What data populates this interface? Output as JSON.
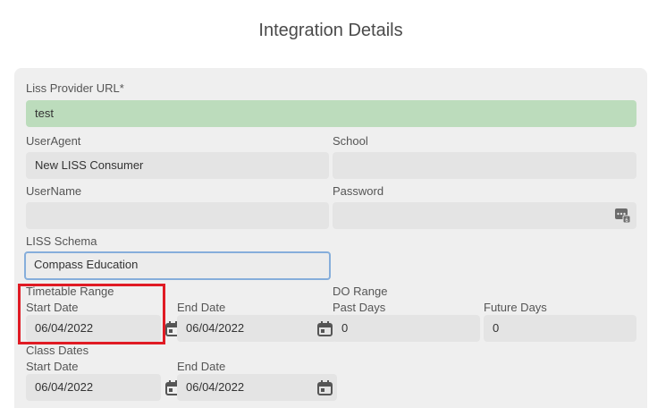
{
  "page": {
    "title": "Integration Details"
  },
  "form": {
    "liss_provider_url": {
      "label": "Liss Provider URL*",
      "value": "test"
    },
    "user_agent": {
      "label": "UserAgent",
      "value": "New LISS Consumer"
    },
    "school": {
      "label": "School",
      "value": ""
    },
    "username": {
      "label": "UserName",
      "value": ""
    },
    "password": {
      "label": "Password",
      "value": "",
      "icon": "password-manager-icon"
    },
    "liss_schema": {
      "label": "LISS Schema",
      "value": "Compass Education"
    },
    "timetable_range": {
      "label": "Timetable Range",
      "start_date": {
        "label": "Start Date",
        "value": "06/04/2022"
      },
      "end_date": {
        "label": "End Date",
        "value": "06/04/2022"
      }
    },
    "do_range": {
      "label": "DO Range",
      "past_days": {
        "label": "Past Days",
        "value": "0"
      },
      "future_days": {
        "label": "Future Days",
        "value": "0"
      }
    },
    "class_dates": {
      "label": "Class Dates",
      "start_date": {
        "label": "Start Date",
        "value": "06/04/2022"
      },
      "end_date": {
        "label": "End Date",
        "value": "06/04/2022"
      }
    }
  },
  "annotation": {
    "highlight_color": "#e01b24"
  },
  "colors": {
    "valid_field": "#bcdcbc",
    "focus_border": "#86aedb",
    "panel": "#efefef"
  }
}
